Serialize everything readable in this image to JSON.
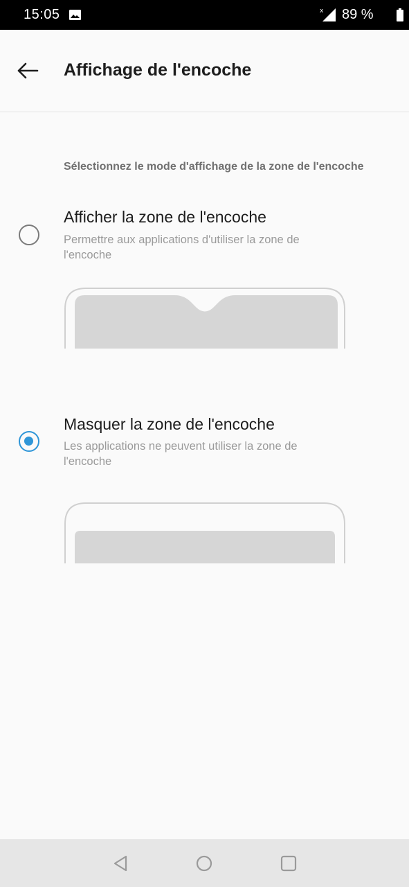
{
  "status_bar": {
    "time": "15:05",
    "battery": "89 %",
    "icons": [
      "image-icon",
      "signal-icon",
      "battery-icon"
    ]
  },
  "toolbar": {
    "title": "Affichage de l'encoche",
    "back_icon": "arrow-left-icon"
  },
  "section": {
    "header": "Sélectionnez le mode d'affichage de la zone de l'encoche"
  },
  "options": [
    {
      "title": "Afficher la zone de l'encoche",
      "summary": "Permettre aux applications d'utiliser la zone de l'encoche",
      "selected": false
    },
    {
      "title": "Masquer la zone de l'encoche",
      "summary": "Les applications ne peuvent utiliser la zone de l'encoche",
      "selected": true
    }
  ],
  "colors": {
    "accent": "#2f96d8",
    "background": "#fafafa",
    "status_bar": "#000000",
    "nav_bar": "#e6e6e6"
  },
  "nav_bar": {
    "icons": [
      "back-triangle-icon",
      "home-circle-icon",
      "recents-square-icon"
    ]
  }
}
